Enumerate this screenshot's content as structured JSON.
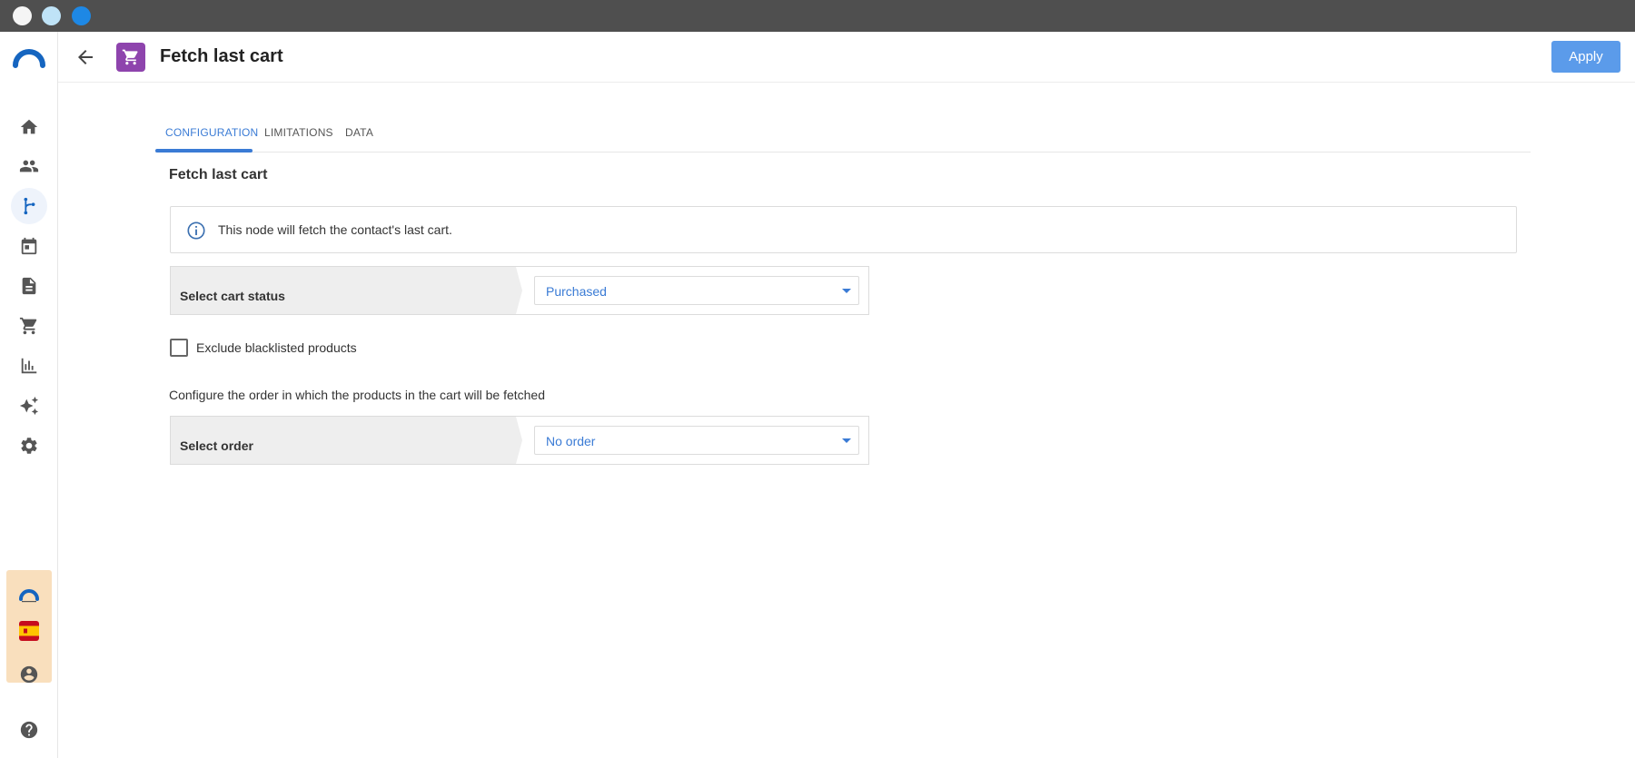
{
  "header": {
    "title": "Fetch last cart",
    "apply_label": "Apply"
  },
  "tabs": [
    {
      "label": "CONFIGURATION",
      "active": true
    },
    {
      "label": "LIMITATIONS",
      "active": false
    },
    {
      "label": "DATA",
      "active": false
    }
  ],
  "section": {
    "title": "Fetch last cart",
    "info_text": "This node will fetch the contact's last cart."
  },
  "cart_status": {
    "label": "Select cart status",
    "value": "Purchased"
  },
  "exclude_blacklisted": {
    "label": "Exclude blacklisted products",
    "checked": false
  },
  "order": {
    "note": "Configure the order in which the products in the cart will be fetched",
    "label": "Select order",
    "value": "No order"
  },
  "sidebar": {
    "items": [
      {
        "icon": "home-icon"
      },
      {
        "icon": "contacts-icon"
      },
      {
        "icon": "workflow-icon",
        "active": true
      },
      {
        "icon": "calendar-icon"
      },
      {
        "icon": "document-icon"
      },
      {
        "icon": "cart-icon"
      },
      {
        "icon": "bar-chart-icon"
      },
      {
        "icon": "sparkles-icon"
      },
      {
        "icon": "settings-icon"
      }
    ],
    "bottom": [
      {
        "icon": "account-icon"
      },
      {
        "icon": "help-icon"
      }
    ]
  },
  "colors": {
    "accent": "#3a7bd5",
    "apply_button": "#5b9bea",
    "node_icon_bg": "#8e44ad",
    "promo_bg": "#f9dfbd"
  }
}
